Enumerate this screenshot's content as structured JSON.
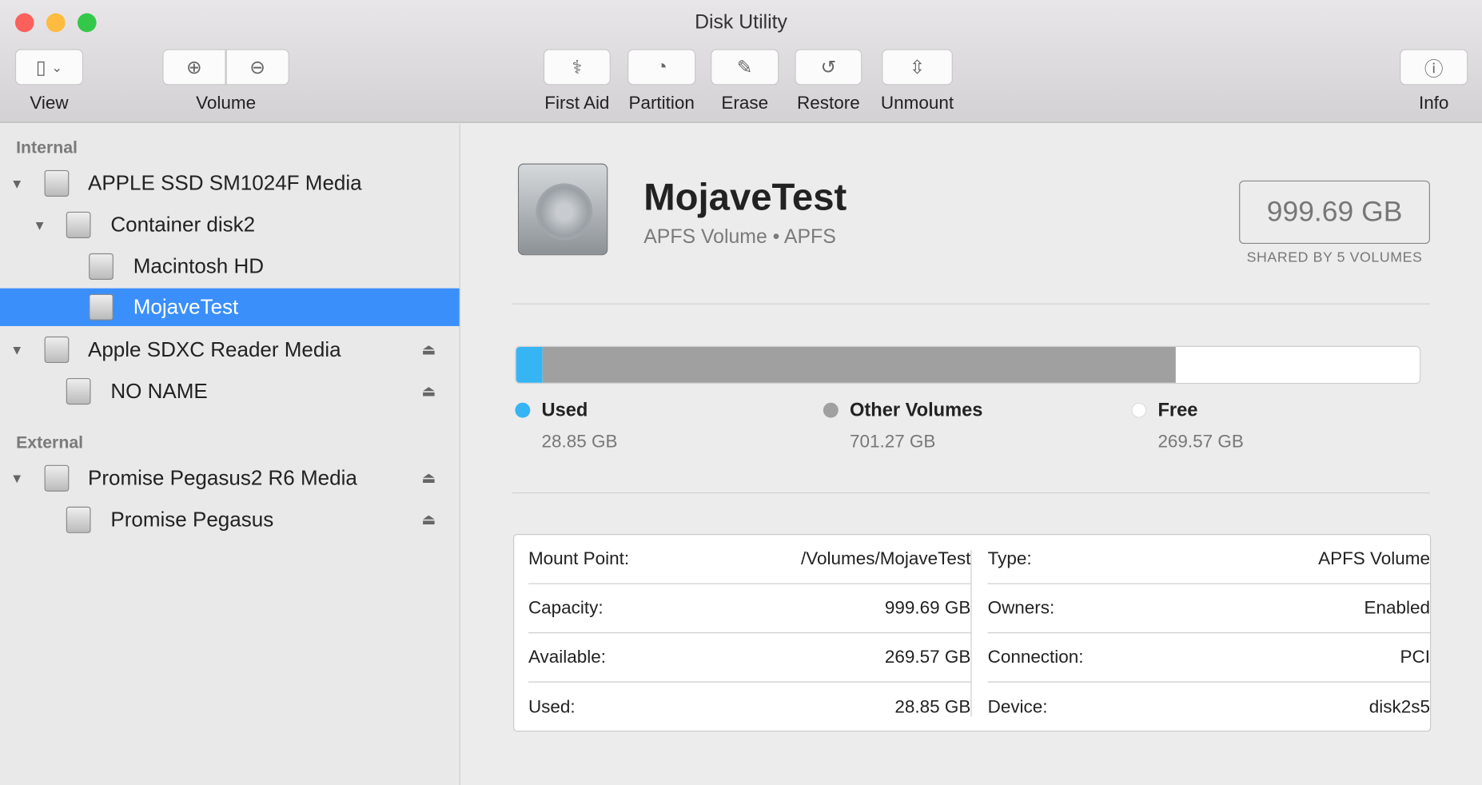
{
  "window": {
    "title": "Disk Utility"
  },
  "toolbar": {
    "view": "View",
    "volume": "Volume",
    "first_aid": "First Aid",
    "partition": "Partition",
    "erase": "Erase",
    "restore": "Restore",
    "unmount": "Unmount",
    "info": "Info"
  },
  "sidebar": {
    "internal": "Internal",
    "external": "External",
    "items": [
      {
        "label": "APPLE SSD SM1024F Media"
      },
      {
        "label": "Container disk2"
      },
      {
        "label": "Macintosh HD"
      },
      {
        "label": "MojaveTest"
      },
      {
        "label": "Apple SDXC Reader Media"
      },
      {
        "label": "NO NAME"
      },
      {
        "label": "Promise Pegasus2 R6 Media"
      },
      {
        "label": "Promise Pegasus"
      }
    ]
  },
  "volume": {
    "name": "MojaveTest",
    "subtitle": "APFS Volume • APFS",
    "capacity": "999.69 GB",
    "shared": "SHARED BY 5 VOLUMES"
  },
  "usage": {
    "used_fraction": 0.0289,
    "other_fraction": 0.7015,
    "free_fraction": 0.2696,
    "colors": {
      "used": "#35b5f4",
      "other": "#a0a0a0",
      "free": "#ffffff"
    },
    "legend": [
      {
        "label": "Used",
        "value": "28.85 GB"
      },
      {
        "label": "Other Volumes",
        "value": "701.27 GB"
      },
      {
        "label": "Free",
        "value": "269.57 GB"
      }
    ]
  },
  "details": {
    "left": [
      {
        "k": "Mount Point:",
        "v": "/Volumes/MojaveTest"
      },
      {
        "k": "Capacity:",
        "v": "999.69 GB"
      },
      {
        "k": "Available:",
        "v": "269.57 GB"
      },
      {
        "k": "Used:",
        "v": "28.85 GB"
      }
    ],
    "right": [
      {
        "k": "Type:",
        "v": "APFS Volume"
      },
      {
        "k": "Owners:",
        "v": "Enabled"
      },
      {
        "k": "Connection:",
        "v": "PCI"
      },
      {
        "k": "Device:",
        "v": "disk2s5"
      }
    ]
  }
}
